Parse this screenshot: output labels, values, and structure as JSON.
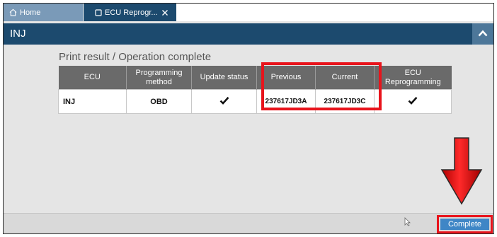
{
  "tabs": [
    {
      "label": "Home",
      "icon": "home-icon"
    },
    {
      "label": "ECU Reprogr...",
      "icon": "window-icon",
      "close_icon": "close-icon"
    }
  ],
  "header": {
    "title": "INJ",
    "collapse_icon": "chevron-up-icon"
  },
  "result": {
    "title": "Print result / Operation complete",
    "columns": [
      "ECU",
      "Programming method",
      "Update status",
      "Previous",
      "Current",
      "ECU Reprogramming"
    ],
    "row": {
      "ecu": "INJ",
      "programming_method": "OBD",
      "update_status": "check",
      "previous": "237617JD3A",
      "current": "237617JD3C",
      "ecu_reprogramming": "check"
    }
  },
  "footer": {
    "complete_label": "Complete"
  },
  "colors": {
    "header_bg": "#1c4a6e",
    "home_tab_bg": "#7a9ab8",
    "table_header_bg": "#6a6a6a",
    "complete_button_bg": "#3f86c6",
    "highlight_red": "#e8141c"
  }
}
